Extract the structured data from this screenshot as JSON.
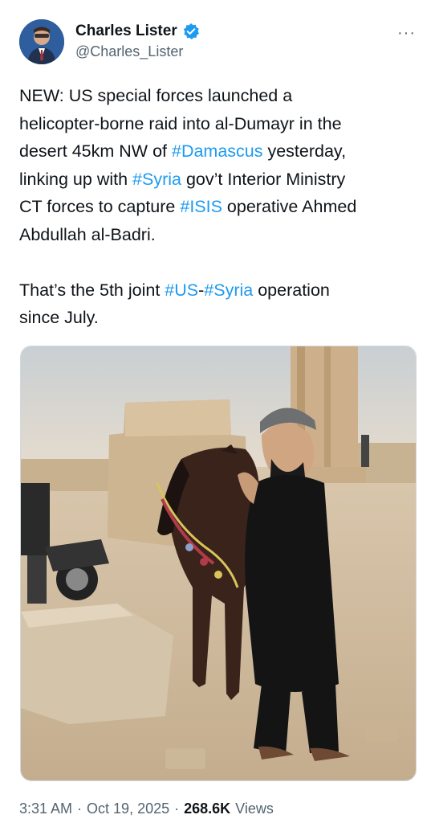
{
  "author": {
    "display_name": "Charles Lister",
    "handle": "@Charles_Lister",
    "verified_icon": "verified-badge-icon",
    "more_label": "···"
  },
  "tweet": {
    "paragraph1": {
      "t1": "NEW: US special forces launched a\nhelicopter-borne raid into al-Dumayr in the\ndesert 45km NW of ",
      "h1": "#Damascus",
      "t2": " yesterday,\nlinking up with ",
      "h2": "#Syria",
      "t3": " gov’t Interior Ministry\nCT forces to capture ",
      "h3": "#ISIS",
      "t4": " operative Ahmed\nAbdullah al-Badri."
    },
    "paragraph2": {
      "t1": "That’s the 5th joint ",
      "h1": "#US",
      "t2": "-",
      "h2": "#Syria",
      "t3": " operation\nsince July."
    }
  },
  "meta": {
    "time": "3:31 AM",
    "sep1": "·",
    "date": "Oct 19, 2025",
    "sep2": "·",
    "views_count": "268.6K",
    "views_label": "Views"
  },
  "colors": {
    "link": "#1d9bf0",
    "secondary_text": "#536471",
    "primary_text": "#0f1419"
  }
}
